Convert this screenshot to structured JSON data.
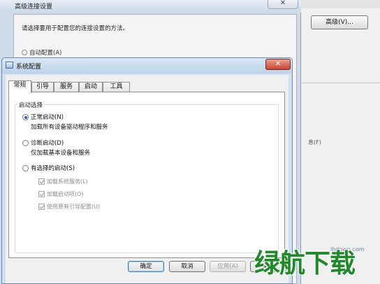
{
  "background_window": {
    "title": "高级连接设置",
    "close_glyph": "✕",
    "prompt": "请选择要用于配置您的连接设置的方法。",
    "auto_config_label": "自动配置(A)"
  },
  "right_pane": {
    "advanced_button": "高级(V)...",
    "partial_text": "息(F)",
    "watermark_url": "lhdown.com"
  },
  "dialog": {
    "title": "系统配置",
    "close_glyph": "✕",
    "tabs": [
      {
        "label": "常规",
        "active": true
      },
      {
        "label": "引导",
        "active": false
      },
      {
        "label": "服务",
        "active": false
      },
      {
        "label": "启动",
        "active": false
      },
      {
        "label": "工具",
        "active": false
      }
    ],
    "group_title": "启动选择",
    "options": [
      {
        "label": "正常启动(N)",
        "description": "加载所有设备驱动程序和服务",
        "checked": true
      },
      {
        "label": "诊断启动(D)",
        "description": "仅加载基本设备和服务",
        "checked": false
      },
      {
        "label": "有选择的启动(S)",
        "description": "",
        "checked": false
      }
    ],
    "selective_items": [
      {
        "label": "加载系统服务(L)",
        "checked": true,
        "enabled": false
      },
      {
        "label": "加载启动项(O)",
        "checked": true,
        "enabled": false
      },
      {
        "label": "使用原有引导配置(U)",
        "checked": true,
        "enabled": false
      }
    ],
    "buttons": {
      "ok": "确定",
      "cancel": "取消",
      "apply": "应用(A)",
      "help": "帮助"
    }
  },
  "watermark": {
    "text": "绿航下载",
    "color": "#1f8a28"
  }
}
